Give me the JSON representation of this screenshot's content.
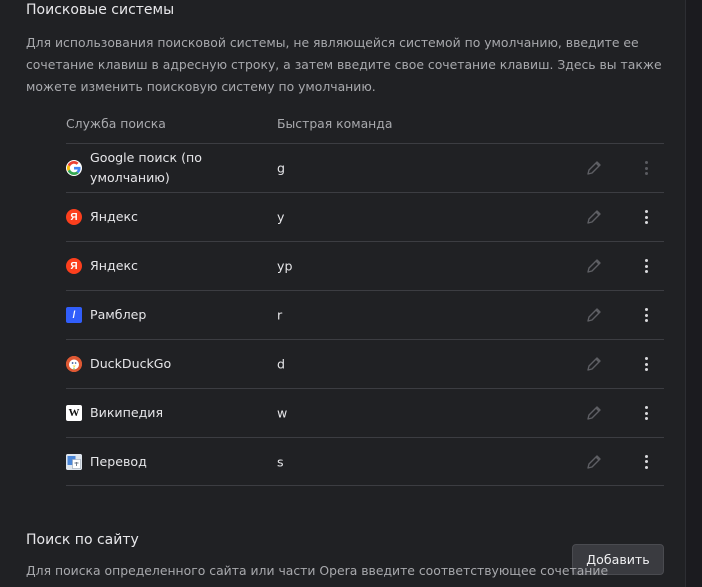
{
  "search_engines": {
    "title": "Поисковые системы",
    "description": "Для использования поисковой системы, не являющейся системой по умолчанию, введите ее сочетание клавиш в адресную строку, а затем введите свое сочетание клавиш. Здесь вы также можете изменить поисковую систему по умолчанию.",
    "columns": {
      "service": "Служба поиска",
      "keyword": "Быстрая команда"
    },
    "rows": [
      {
        "name": "Google поиск (по умолчанию)",
        "keyword": "g",
        "icon": "google-icon",
        "more_enabled": false
      },
      {
        "name": "Яндекс",
        "keyword": "y",
        "icon": "yandex-icon",
        "more_enabled": true
      },
      {
        "name": "Яндекс",
        "keyword": "yp",
        "icon": "yandex-icon",
        "more_enabled": true
      },
      {
        "name": "Рамблер",
        "keyword": "r",
        "icon": "rambler-icon",
        "more_enabled": true
      },
      {
        "name": "DuckDuckGo",
        "keyword": "d",
        "icon": "duckduckgo-icon",
        "more_enabled": true
      },
      {
        "name": "Википедия",
        "keyword": "w",
        "icon": "wikipedia-icon",
        "more_enabled": true
      },
      {
        "name": "Перевод",
        "keyword": "s",
        "icon": "translate-icon",
        "more_enabled": true
      }
    ]
  },
  "site_search": {
    "title": "Поиск по сайту",
    "description": "Для поиска определенного сайта или части Opera введите соответствующее сочетание",
    "add_button": "Добавить"
  },
  "icon_glyphs": {
    "yandex": "Я",
    "rambler": "/",
    "wikipedia": "W"
  },
  "colors": {
    "background": "#202124",
    "divider": "#3c3d42",
    "text": "#e6e6e9",
    "muted": "#a8a9ad"
  }
}
